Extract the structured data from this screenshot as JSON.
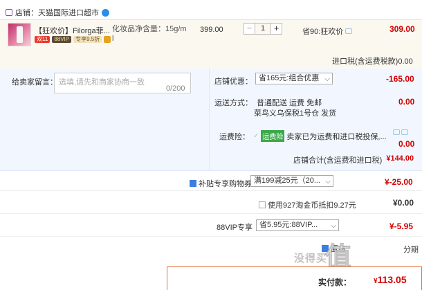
{
  "shop": {
    "label": "店铺：天猫国际进口超市"
  },
  "item": {
    "title": "【狂欢价】Filorga菲...",
    "tags": [
      "双11",
      "88VIP",
      "专享9.5折"
    ],
    "spec": "化妆品净含量：15g/m l",
    "price": "399.00",
    "quantity": "1",
    "minus": "−",
    "plus": "+",
    "promo": "省90:狂欢价",
    "total": "309.00"
  },
  "tax": {
    "label": "进口税(含运费税款)",
    "value": "0.00"
  },
  "message": {
    "label": "给卖家留言：",
    "placeholder": "选填,请先和商家协商一致",
    "count": "0/200"
  },
  "store_discount": {
    "label": "店铺优惠：",
    "selected": "省165元:组合优惠",
    "value": "-165.00"
  },
  "shipping": {
    "label": "运送方式：",
    "method": "普通配送 运费 免邮",
    "warehouse": "菜鸟义乌保税1号仓 发货",
    "value": "0.00"
  },
  "insurance": {
    "label": "运费险：",
    "tag": "运费险",
    "desc": "卖家已为运费和进口税投保,...",
    "value": "0.00"
  },
  "store_total": {
    "label": "店铺合计(含运费和进口税)",
    "value": "¥144.00"
  },
  "coupon": {
    "label": "补贴专享购物券",
    "selected": "满199减25元（20...",
    "value": "¥-25.00"
  },
  "coins": {
    "label": "使用927淘金币抵扣9.27元",
    "value": "¥0.00"
  },
  "vip": {
    "label": "88VIP专享",
    "selected": "省5.95元:88VIP...",
    "value": "¥-5.95"
  },
  "extra": {
    "label": "匿名",
    "right": "分期"
  },
  "grand_total": {
    "label": "实付款：",
    "value": "113.05",
    "prefix": "¥"
  },
  "watermark": {
    "text": "没得买",
    "logo": "值",
    "site": "zhi"
  }
}
